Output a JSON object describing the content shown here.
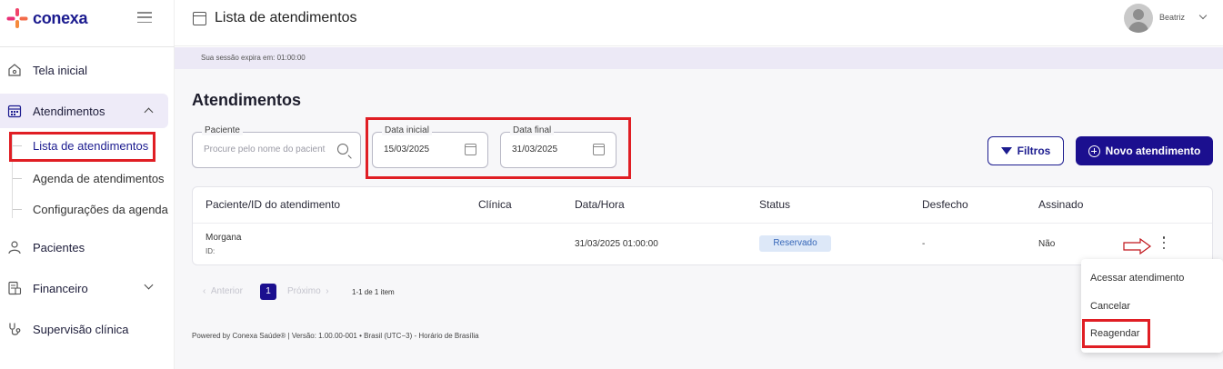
{
  "app": {
    "logo_text": "conexa"
  },
  "topbar": {
    "title": "Lista de atendimentos",
    "user_name": "Beatriz"
  },
  "session": {
    "text": "Sua sessão expira em: 01:00:00"
  },
  "sidebar": {
    "items": [
      {
        "label": "Tela inicial"
      },
      {
        "label": "Atendimentos"
      },
      {
        "label": "Pacientes"
      },
      {
        "label": "Financeiro"
      },
      {
        "label": "Supervisão clínica"
      }
    ],
    "subitems": [
      {
        "label": "Lista de atendimentos"
      },
      {
        "label": "Agenda de atendimentos"
      },
      {
        "label": "Configurações da agenda"
      }
    ]
  },
  "main": {
    "title": "Atendimentos",
    "patient_field": {
      "legend": "Paciente",
      "placeholder": "Procure pelo nome do pacient"
    },
    "start_date": {
      "legend": "Data inicial",
      "value": "15/03/2025"
    },
    "end_date": {
      "legend": "Data final",
      "value": "31/03/2025"
    },
    "filters_label": "Filtros",
    "new_label": "Novo atendimento"
  },
  "table": {
    "headers": [
      "Paciente/ID do atendimento",
      "Clínica",
      "Data/Hora",
      "Status",
      "Desfecho",
      "Assinado"
    ],
    "rows": [
      {
        "patient": "Morgana",
        "id": "ID:",
        "clinic": "",
        "datetime": "31/03/2025 01:00:00",
        "status": "Reservado",
        "outcome": "-",
        "signed": "Não"
      }
    ]
  },
  "pagination": {
    "prev": "Anterior",
    "page": "1",
    "next": "Próximo",
    "range": "1-1 de 1 item"
  },
  "footer": {
    "text": "Powered by Conexa Saúde® | Versão: 1.00.00-001 • Brasil (UTC−3) - Horário de Brasília"
  },
  "context_menu": {
    "items": [
      "Acessar atendimento",
      "Cancelar",
      "Reagendar"
    ]
  },
  "colors": {
    "brand": "#1b0f8f",
    "highlight": "#e01e24",
    "status_badge_bg": "#dde8f8"
  }
}
